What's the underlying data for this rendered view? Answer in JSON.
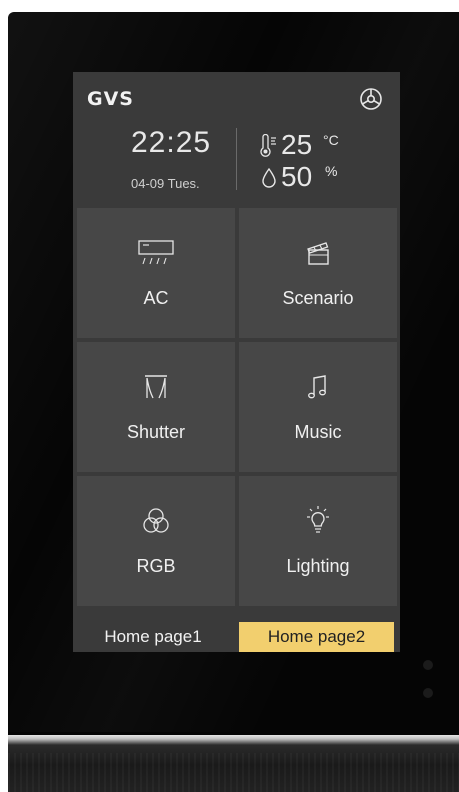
{
  "header": {
    "brand": "GVS"
  },
  "clock": {
    "time": "22:25",
    "date": "04-09 Tues."
  },
  "climate": {
    "temperature": "25",
    "temperature_unit": "°C",
    "humidity": "50",
    "humidity_unit": "%"
  },
  "tiles": [
    {
      "label": "AC",
      "icon": "air-conditioner-icon"
    },
    {
      "label": "Scenario",
      "icon": "clapperboard-icon"
    },
    {
      "label": "Shutter",
      "icon": "curtain-icon"
    },
    {
      "label": "Music",
      "icon": "music-note-icon"
    },
    {
      "label": "RGB",
      "icon": "rgb-circles-icon"
    },
    {
      "label": "Lighting",
      "icon": "light-bulb-icon"
    }
  ],
  "tabs": [
    {
      "label": "Home page1",
      "active": false
    },
    {
      "label": "Home page2",
      "active": true
    }
  ],
  "colors": {
    "screen_bg": "#3a3a3a",
    "tile_bg": "#474747",
    "active_tab": "#f2cf6e"
  }
}
